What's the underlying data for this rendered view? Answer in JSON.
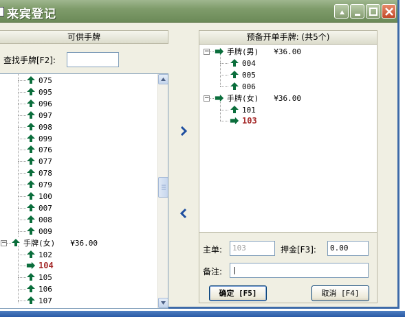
{
  "window": {
    "title": "来宾登记"
  },
  "left": {
    "header": "可供手牌",
    "search_label": "查找手牌[F2]:",
    "search_value": "",
    "items": [
      {
        "label": "075",
        "icon": "up-arrow-icon"
      },
      {
        "label": "095",
        "icon": "up-arrow-icon"
      },
      {
        "label": "096",
        "icon": "up-arrow-icon"
      },
      {
        "label": "097",
        "icon": "up-arrow-icon"
      },
      {
        "label": "098",
        "icon": "up-arrow-icon"
      },
      {
        "label": "099",
        "icon": "up-arrow-icon"
      },
      {
        "label": "076",
        "icon": "up-arrow-icon"
      },
      {
        "label": "077",
        "icon": "up-arrow-icon"
      },
      {
        "label": "078",
        "icon": "up-arrow-icon"
      },
      {
        "label": "079",
        "icon": "up-arrow-icon"
      },
      {
        "label": "100",
        "icon": "up-arrow-icon"
      },
      {
        "label": "007",
        "icon": "up-arrow-icon"
      },
      {
        "label": "008",
        "icon": "up-arrow-icon"
      },
      {
        "label": "009",
        "icon": "up-arrow-icon"
      }
    ],
    "group_female": {
      "label": "手牌(女)",
      "price": "¥36.00",
      "expander": "−"
    },
    "female_items": [
      {
        "label": "102",
        "selected": false
      },
      {
        "label": "104",
        "selected": true
      },
      {
        "label": "105",
        "selected": false
      },
      {
        "label": "106",
        "selected": false
      },
      {
        "label": "107",
        "selected": false
      }
    ]
  },
  "right": {
    "header": "预备开单手牌: (共5个)",
    "groups": [
      {
        "label": "手牌(男)",
        "price": "¥36.00",
        "expander": "−",
        "items": [
          {
            "label": "004",
            "selected": false
          },
          {
            "label": "005",
            "selected": false
          },
          {
            "label": "006",
            "selected": false
          }
        ]
      },
      {
        "label": "手牌(女)",
        "price": "¥36.00",
        "expander": "−",
        "items": [
          {
            "label": "101",
            "selected": false
          },
          {
            "label": "103",
            "selected": true
          }
        ]
      }
    ],
    "form": {
      "main_label": "主单:",
      "main_value": "103",
      "deposit_label": "押金[F3]:",
      "deposit_value": "0.00",
      "note_label": "备注:",
      "note_value": "|"
    },
    "buttons": {
      "ok": "确定 [F5]",
      "cancel": "取消 [F4]"
    }
  },
  "colors": {
    "title_bar": "#7f9c6b",
    "selected_text": "#a52a2a",
    "arrow_green": "#0b6e3c",
    "nav_arrow": "#1f4fa0"
  }
}
